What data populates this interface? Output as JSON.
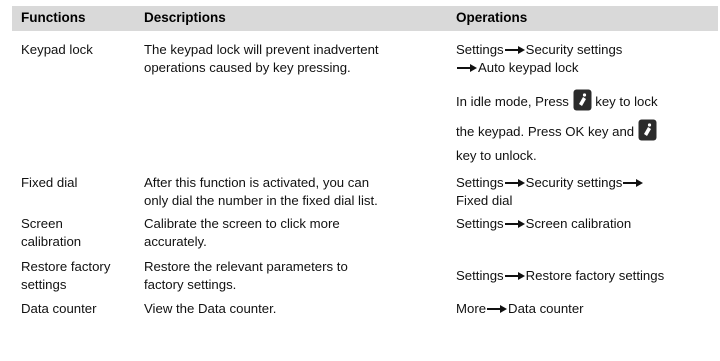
{
  "header": {
    "functions": "Functions",
    "descriptions": "Descriptions",
    "operations": "Operations"
  },
  "rows": {
    "keypad_lock": {
      "function": "Keypad lock",
      "desc_line1": "The keypad lock will prevent inadvertent",
      "desc_line2": "operations caused by key pressing.",
      "op_settings": "Settings",
      "op_security": "Security settings",
      "op_auto": "Auto keypad lock",
      "idle_prefix": "In idle mode, Press",
      "idle_suffix": "key to lock",
      "unlock_prefix": "the keypad. Press OK key and",
      "unlock_suffix": "key to unlock."
    },
    "fixed_dial": {
      "function": "Fixed dial",
      "desc_line1": "After this function is activated, you can",
      "desc_line2": "only dial the number in the fixed dial list.",
      "op_settings": "Settings",
      "op_security": "Security settings",
      "op_fixed": "Fixed dial"
    },
    "screen_calibration": {
      "function_line1": "Screen",
      "function_line2": "calibration",
      "desc_line1": "Calibrate the screen to click more",
      "desc_line2": "accurately.",
      "op_settings": "Settings",
      "op_target": "Screen calibration"
    },
    "restore_factory": {
      "function_line1": "Restore factory",
      "function_line2": "settings",
      "desc_line1": "Restore the relevant parameters to",
      "desc_line2": "factory settings.",
      "op_settings": "Settings",
      "op_target": "Restore factory settings"
    },
    "data_counter": {
      "function": "Data counter",
      "desc": "View the Data counter.",
      "op_more": "More",
      "op_target": "Data counter"
    }
  },
  "icons": {
    "arrow": "right-arrow-icon",
    "key": "end-key-icon"
  },
  "colors": {
    "header_bg": "#d9d9d9",
    "key_icon": "#2b2b2b"
  }
}
